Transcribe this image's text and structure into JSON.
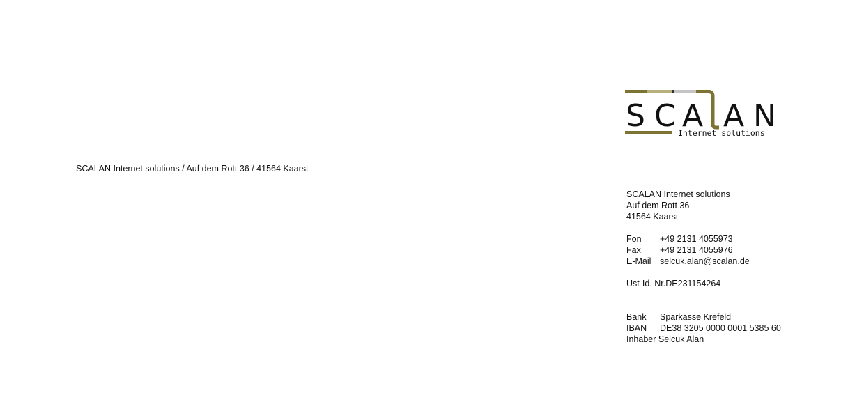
{
  "sender_line": "SCALAN Internet solutions / Auf dem Rott 36 / 41564 Kaarst",
  "logo": {
    "wordmark": "SCALAN",
    "tagline": "Internet solutions",
    "colors": {
      "olive": "#7d7333",
      "khaki": "#b7b07c",
      "grey": "#c5c5c5",
      "text": "#111111"
    }
  },
  "company": {
    "name": "SCALAN Internet solutions",
    "street": "Auf dem Rott 36",
    "city": "41564 Kaarst"
  },
  "contact": [
    {
      "label": "Fon",
      "value": "+49 2131 4055973"
    },
    {
      "label": "Fax",
      "value": "+49 2131 4055976"
    },
    {
      "label": "E-Mail",
      "value": "selcuk.alan@scalan.de"
    }
  ],
  "tax_id": "Ust-Id. Nr.DE231154264",
  "bank": [
    {
      "label": "Bank",
      "value": "Sparkasse Krefeld"
    },
    {
      "label": "IBAN",
      "value": "DE38 3205 0000 0001 5385 60"
    }
  ],
  "owner": {
    "label": "Inhaber",
    "value": "Selcuk Alan"
  }
}
